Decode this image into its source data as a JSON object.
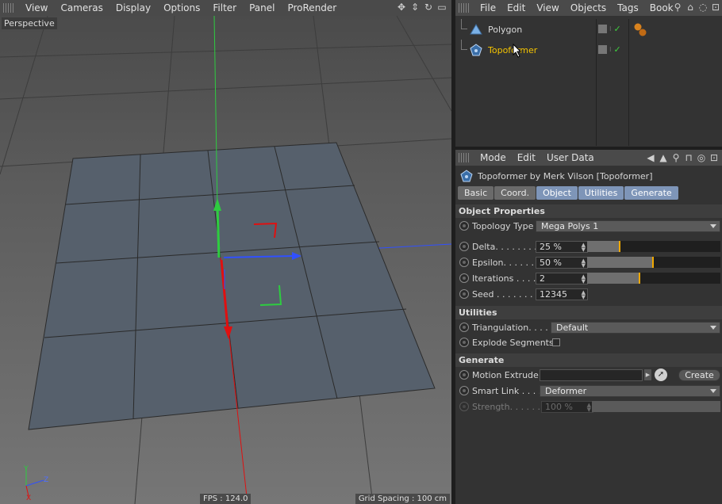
{
  "viewport": {
    "menu": [
      "View",
      "Cameras",
      "Display",
      "Options",
      "Filter",
      "Panel",
      "ProRender"
    ],
    "label": "Perspective",
    "fps": "FPS : 124.0",
    "grid_spacing": "Grid Spacing : 100 cm",
    "axis_y": "Y",
    "axis_z": "Z",
    "axis_x": "X"
  },
  "object_manager": {
    "menu": [
      "File",
      "Edit",
      "View",
      "Objects",
      "Tags",
      "Book"
    ],
    "objects": [
      {
        "name": "Polygon",
        "selected": false
      },
      {
        "name": "Topoformer",
        "selected": true
      }
    ]
  },
  "attribute_manager": {
    "menu": [
      "Mode",
      "Edit",
      "User Data"
    ],
    "title": "Topoformer by Merk Vilson [Topoformer]",
    "tabs": [
      "Basic",
      "Coord.",
      "Object",
      "Utilities",
      "Generate"
    ],
    "active_tabs": [
      "Object",
      "Utilities",
      "Generate"
    ],
    "sections": {
      "object_properties": "Object Properties",
      "utilities": "Utilities",
      "generate": "Generate"
    },
    "fields": {
      "topology_type": {
        "label": "Topology Type",
        "value": "Mega Polys 1"
      },
      "delta": {
        "label": "Delta. . . . . . . .",
        "value": "25 %",
        "fraction": 0.25
      },
      "epsilon": {
        "label": "Epsilon. . . . . .",
        "value": "50 %",
        "fraction": 0.5
      },
      "iterations": {
        "label": "Iterations . . . .",
        "value": "2",
        "fraction": 0.4
      },
      "seed": {
        "label": "Seed . . . . . . . .",
        "value": "12345"
      },
      "triangulation": {
        "label": "Triangulation. . . .",
        "value": "Default"
      },
      "explode_segments": {
        "label": "Explode Segments",
        "checked": false
      },
      "motion_extrude": {
        "label": "Motion Extrude",
        "button": "Create"
      },
      "smart_link": {
        "label": "Smart Link . . . . .",
        "value": "Deformer"
      },
      "strength": {
        "label": "Strength. . . . . .",
        "value": "100 %"
      }
    }
  },
  "colors": {
    "selected_object": "#f5c400",
    "active_tab": "#7e95b8",
    "slider_mark": "#f0a800",
    "y_axis": "#2ecc40",
    "x_axis": "#e01010",
    "z_axis": "#3050ff"
  }
}
